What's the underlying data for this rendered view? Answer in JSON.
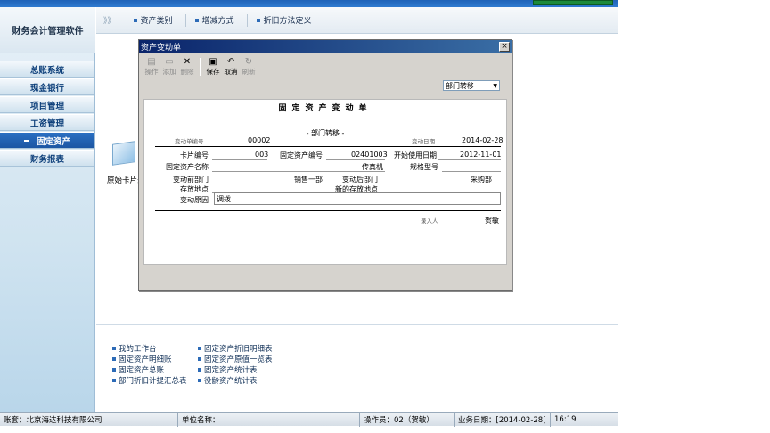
{
  "app": {
    "logo_text": "财务会计管理软件"
  },
  "sidebar": {
    "items": [
      {
        "label": "总账系统"
      },
      {
        "label": "现金银行"
      },
      {
        "label": "项目管理"
      },
      {
        "label": "工资管理"
      },
      {
        "label": "固定资产",
        "active": true
      },
      {
        "label": "财务报表"
      }
    ]
  },
  "header": {
    "chevron": "》》",
    "tabs": [
      {
        "label": "资产类别"
      },
      {
        "label": "增减方式"
      },
      {
        "label": "折旧方法定义"
      }
    ]
  },
  "desktop": {
    "icon_label": "原始卡片录"
  },
  "dialog": {
    "title": "资产变动单",
    "close": "×",
    "toolbar": {
      "print": "操作",
      "add": "添加",
      "delete": "删除",
      "save": "保存",
      "cancel": "取消",
      "refresh": "刷新"
    },
    "change_type_select": "部门转移",
    "document": {
      "title": "固定资产变动单",
      "subtitle": "- 部门转移 -",
      "doc_no_label": "变动单编号",
      "doc_no": "00002",
      "doc_date_label": "变动日期",
      "doc_date": "2014-02-28",
      "card_no_label": "卡片编号",
      "card_no": "003",
      "asset_no_label": "固定资产编号",
      "asset_no": "02401003",
      "start_date_label": "开始使用日期",
      "start_date": "2012-11-01",
      "asset_name_label": "固定资产名称",
      "asset_name": "传真机",
      "spec_label": "规格型号",
      "spec": "",
      "dept_before_label": "变动前部门",
      "dept_before": "销售一部",
      "dept_after_label": "变动后部门",
      "dept_after": "采购部",
      "location_label": "存放地点",
      "new_location_label": "新的存放地点",
      "reason_label": "变动原因",
      "reason": "调拨",
      "operator_label": "录入人",
      "operator": "贺敏"
    }
  },
  "links": {
    "left": [
      "我的工作台",
      "固定资产明细账",
      "固定资产总账",
      "部门折旧计提汇总表"
    ],
    "right": [
      "固定资产折旧明细表",
      "固定资产原值一览表",
      "固定资产统计表",
      "役龄资产统计表"
    ]
  },
  "status": {
    "account": "账套：北京海达科技有限公司",
    "unit": "单位名称：",
    "operator": "操作员：02（贺敏）",
    "business_date": "业务日期：[2014-02-28]",
    "time": "16:19"
  }
}
